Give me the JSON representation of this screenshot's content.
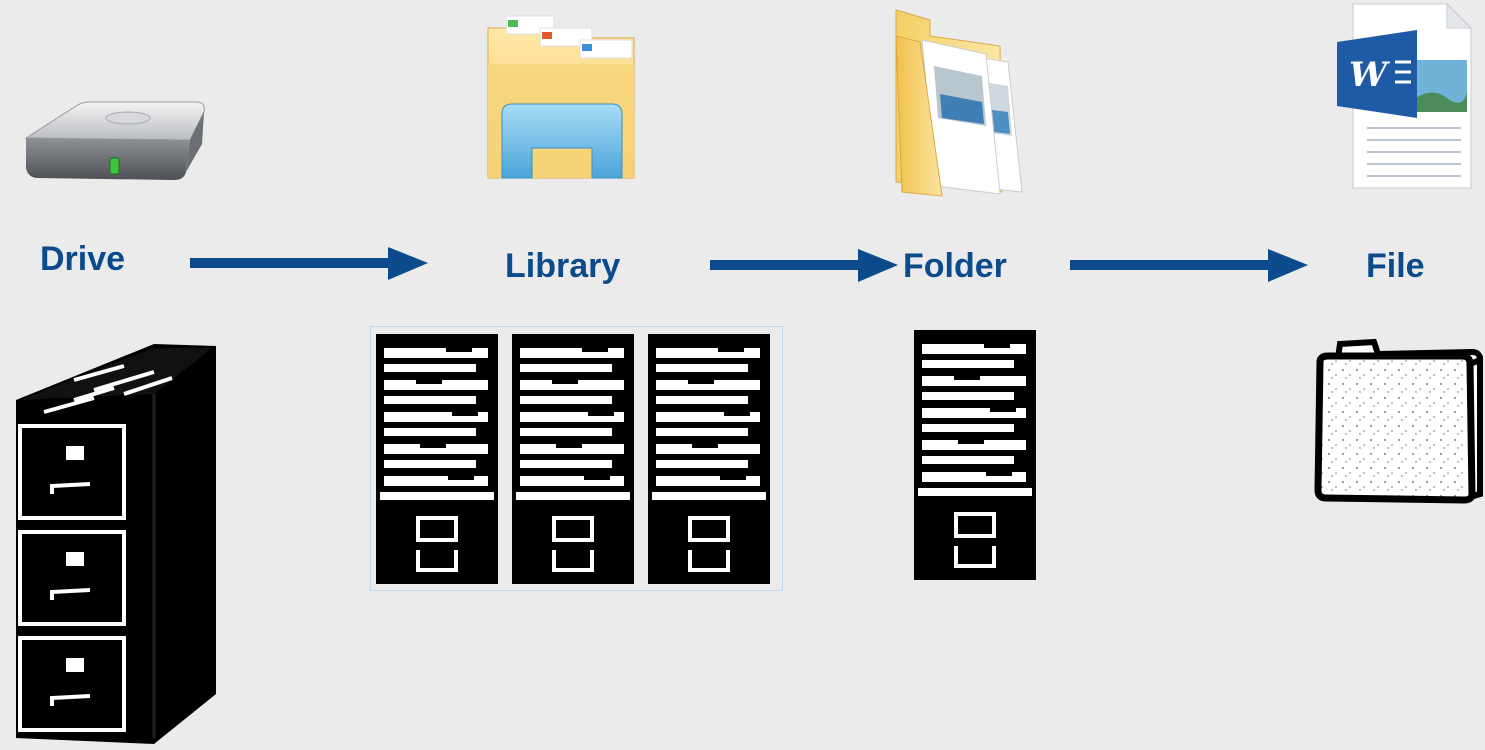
{
  "colors": {
    "background": "#ebebeb",
    "label": "#0b4a8b",
    "arrow": "#0b4a8b"
  },
  "diagram": {
    "stages": [
      {
        "label": "Drive",
        "top_icon": "hard-drive-icon",
        "bottom_icon": "filing-cabinet-icon"
      },
      {
        "label": "Library",
        "top_icon": "file-explorer-folder-icon",
        "bottom_icon": "card-catalog-cabinets-icon"
      },
      {
        "label": "Folder",
        "top_icon": "open-folder-documents-icon",
        "bottom_icon": "card-catalog-cabinet-icon"
      },
      {
        "label": "File",
        "top_icon": "word-document-icon",
        "bottom_icon": "manila-file-folder-icon"
      }
    ]
  }
}
